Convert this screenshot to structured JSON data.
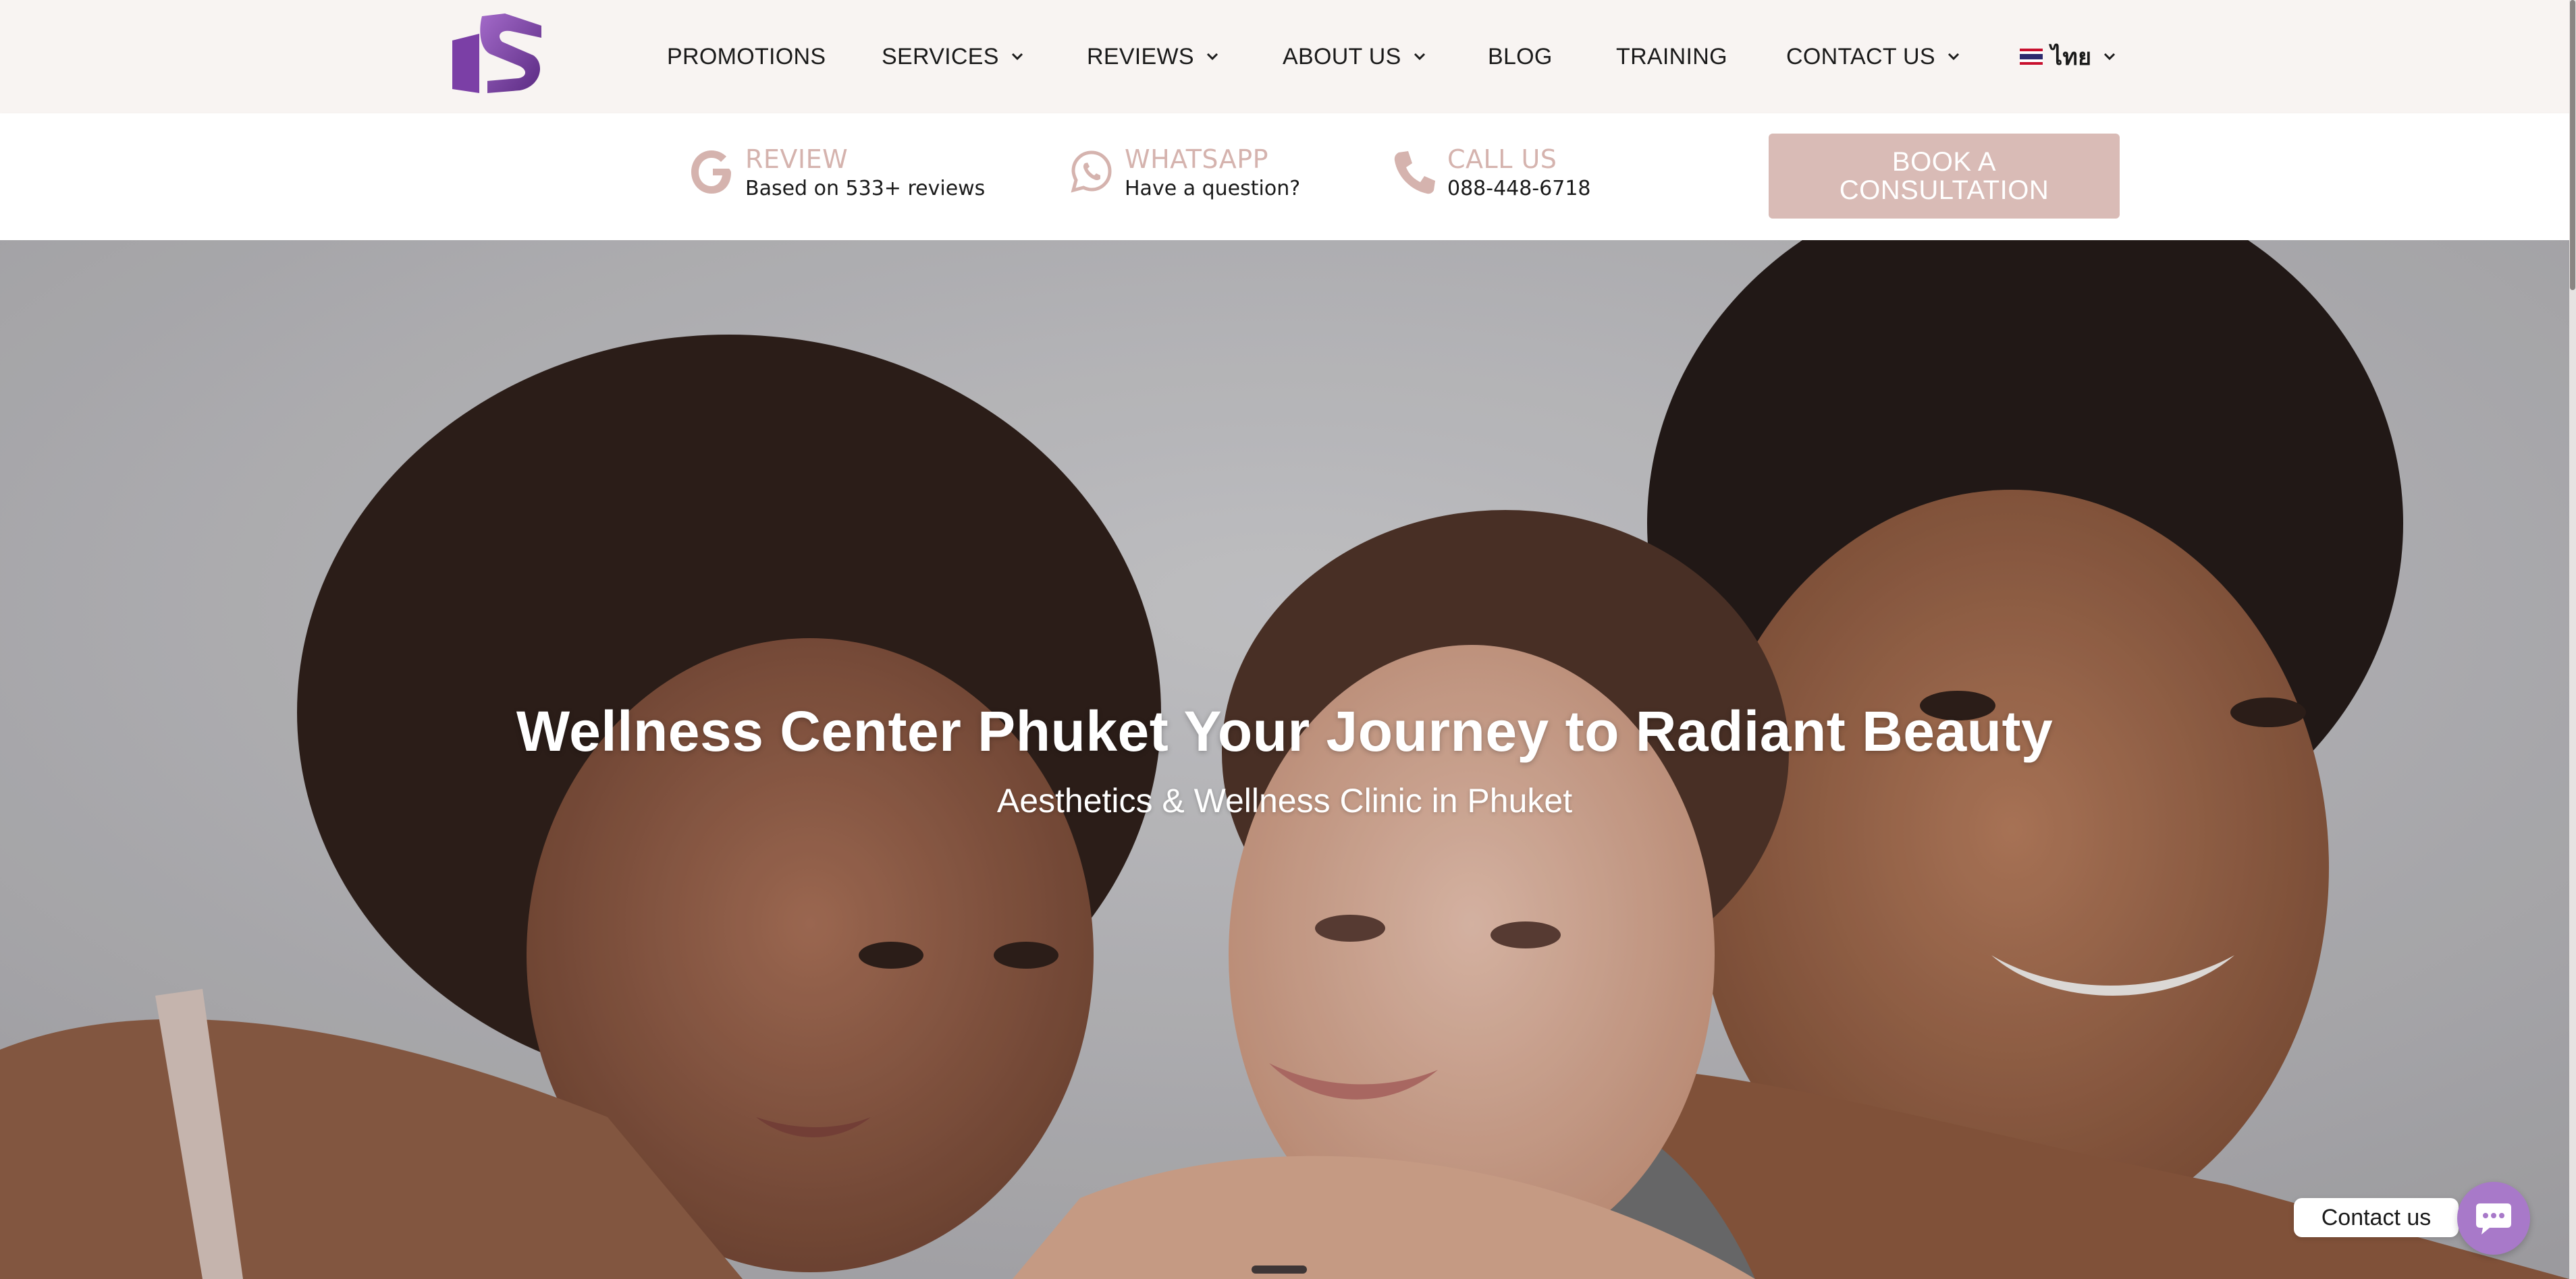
{
  "brand": {
    "logo_letter": "S",
    "accent": "#7c3fa3",
    "accent_light": "#a879c9",
    "soft_pink": "#d9bbb6"
  },
  "nav": {
    "items": [
      {
        "label": "PROMOTIONS",
        "has_dropdown": false
      },
      {
        "label": "SERVICES",
        "has_dropdown": true
      },
      {
        "label": "REVIEWS",
        "has_dropdown": true
      },
      {
        "label": "ABOUT US",
        "has_dropdown": true
      },
      {
        "label": "BLOG",
        "has_dropdown": false
      },
      {
        "label": "TRAINING",
        "has_dropdown": false
      },
      {
        "label": "CONTACT US",
        "has_dropdown": true
      }
    ],
    "language": {
      "label": "ไทย",
      "icon": "thai-flag-icon"
    }
  },
  "infobar": {
    "review": {
      "title": "REVIEW",
      "subtitle": "Based on 533+ reviews",
      "icon": "google-g-icon"
    },
    "whatsapp": {
      "title": "WHATSAPP",
      "subtitle": "Have a question?",
      "icon": "whatsapp-icon"
    },
    "call": {
      "title": "CALL US",
      "subtitle": "088-448-6718",
      "icon": "phone-icon"
    },
    "book_button": "BOOK A CONSULTATION"
  },
  "hero": {
    "title": "Wellness Center Phuket Your Journey to Radiant Beauty",
    "subtitle": "Aesthetics & Wellness Clinic in Phuket"
  },
  "contact_widget": {
    "label": "Contact us",
    "icon": "chat-bubble-icon"
  }
}
